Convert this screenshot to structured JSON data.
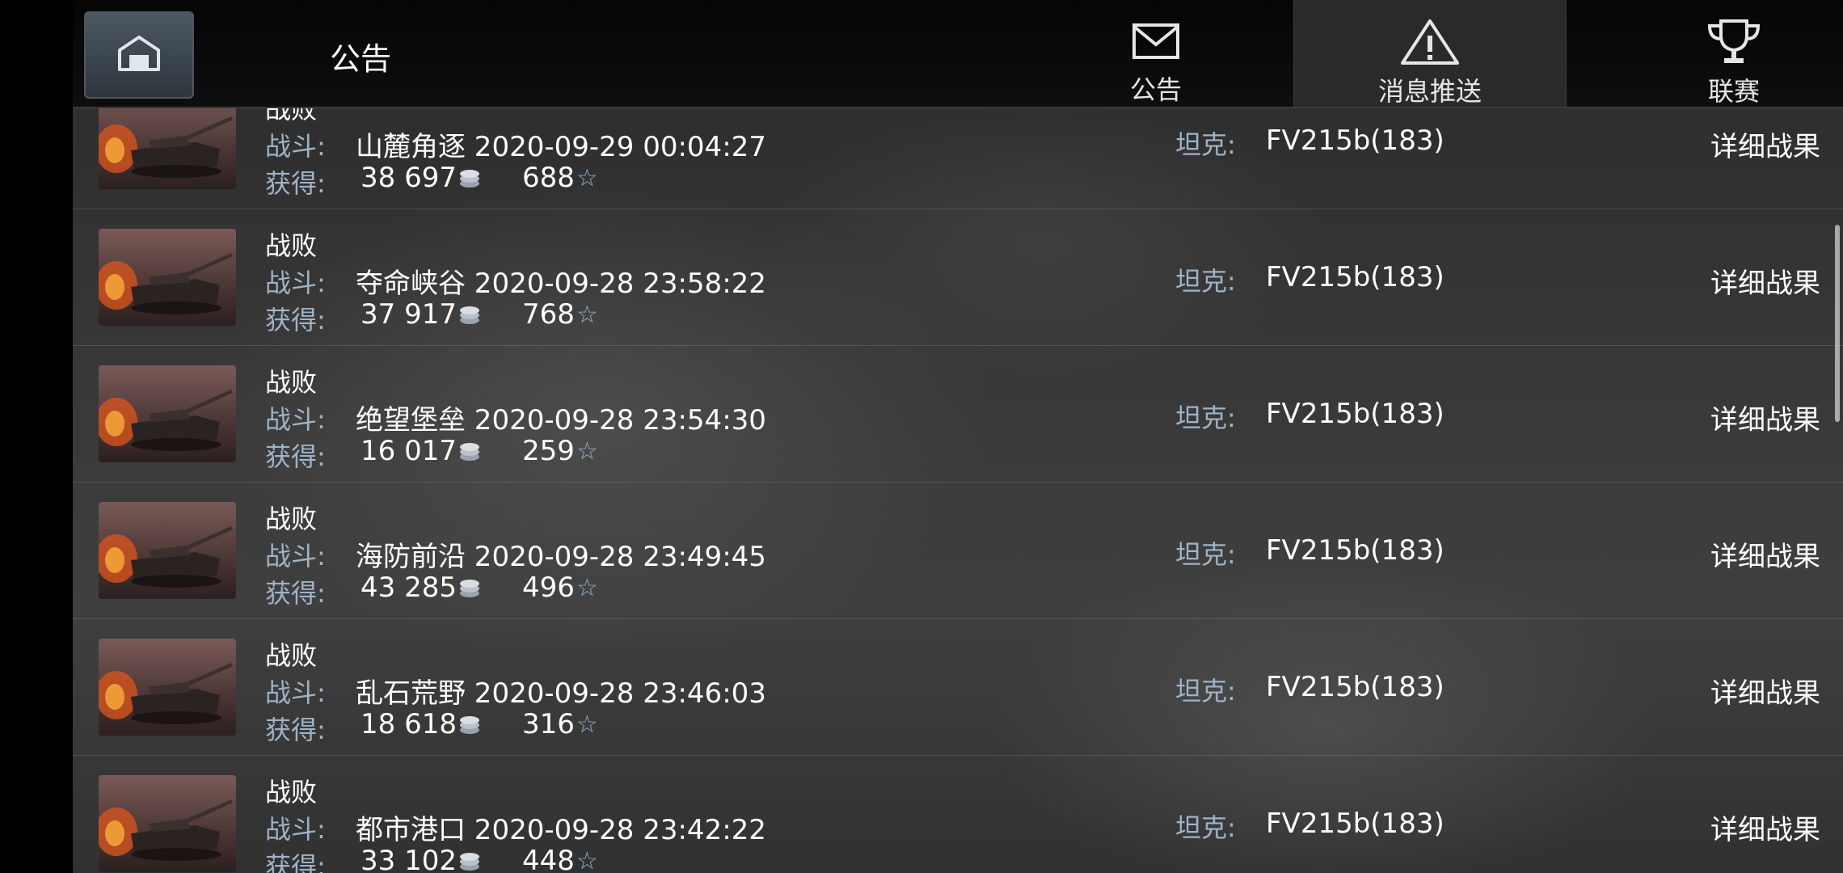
{
  "header": {
    "title": "公告",
    "tabs": [
      {
        "label": "公告",
        "icon": "mail-icon",
        "active": false
      },
      {
        "label": "消息推送",
        "icon": "warning-icon",
        "active": true
      },
      {
        "label": "联赛",
        "icon": "trophy-icon",
        "active": false
      }
    ]
  },
  "list": {
    "battle_label": "战斗:",
    "earn_label": "获得:",
    "tank_label": "坦克:",
    "details_label": "详细战果",
    "items": [
      {
        "result": "战败",
        "battle": "山麓角逐 2020-09-29 00:04:27",
        "credits": "38 697",
        "xp": "688",
        "tank": "FV215b(183)"
      },
      {
        "result": "战败",
        "battle": "夺命峡谷 2020-09-28 23:58:22",
        "credits": "37 917",
        "xp": "768",
        "tank": "FV215b(183)"
      },
      {
        "result": "战败",
        "battle": "绝望堡垒 2020-09-28 23:54:30",
        "credits": "16 017",
        "xp": "259",
        "tank": "FV215b(183)"
      },
      {
        "result": "战败",
        "battle": "海防前沿 2020-09-28 23:49:45",
        "credits": "43 285",
        "xp": "496",
        "tank": "FV215b(183)"
      },
      {
        "result": "战败",
        "battle": "乱石荒野 2020-09-28 23:46:03",
        "credits": "18 618",
        "xp": "316",
        "tank": "FV215b(183)"
      },
      {
        "result": "战败",
        "battle": "都市港口 2020-09-28 23:42:22",
        "credits": "33 102",
        "xp": "448",
        "tank": "FV215b(183)"
      }
    ]
  },
  "colors": {
    "label_blue": "#9fb3c8",
    "star_blue": "#8fb1d8",
    "active_tab_bg": "#2a2a2a"
  }
}
